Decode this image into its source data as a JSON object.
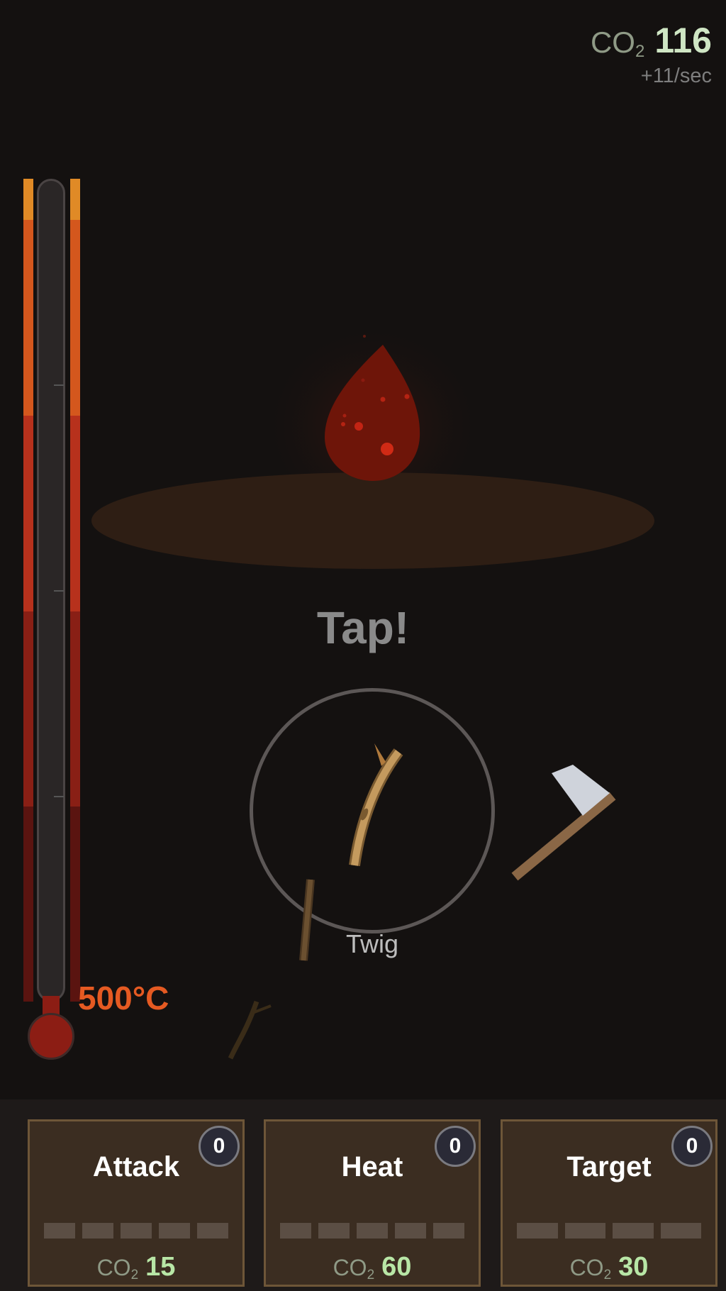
{
  "co2": {
    "label_main": "CO",
    "label_sub": "2",
    "value": "116",
    "rate": "+11/sec"
  },
  "thermometer": {
    "temperature": "500°C"
  },
  "fire": {
    "prompt": "Tap!",
    "item_name": "Twig"
  },
  "upgrades": [
    {
      "title": "Attack",
      "level": "0",
      "cost_label": "CO",
      "cost_sub": "2",
      "cost": "15",
      "slots": 5
    },
    {
      "title": "Heat",
      "level": "0",
      "cost_label": "CO",
      "cost_sub": "2",
      "cost": "60",
      "slots": 5
    },
    {
      "title": "Target",
      "level": "0",
      "cost_label": "CO",
      "cost_sub": "2",
      "cost": "30",
      "slots": 4
    }
  ],
  "colors": {
    "background": "#141110",
    "fire": "#6e1509",
    "ember": "#d02a15",
    "temperature_text": "#e55a22",
    "co2_value": "#cfe6c4",
    "card_bg": "#3b2d21"
  },
  "icons": {
    "fire": "fire-drop-icon",
    "twig": "twig-icon",
    "axe": "axe-icon"
  }
}
